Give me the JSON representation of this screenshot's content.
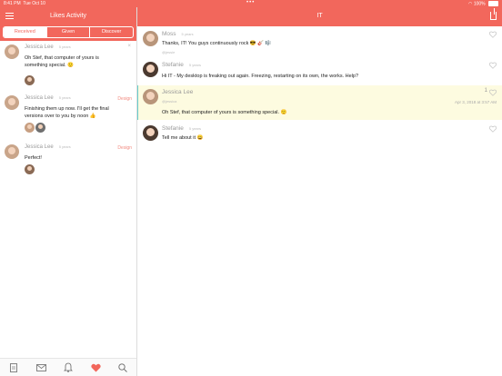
{
  "status_bar": {
    "time": "8:41 PM",
    "date": "Tue Oct 10",
    "battery": "100%"
  },
  "left": {
    "title": "Likes Activity",
    "tabs": [
      "Received",
      "Given",
      "Discover"
    ],
    "items": [
      {
        "name": "Jessica Lee",
        "ago": "5 years",
        "tag": "",
        "text": "Oh Stef, that computer of yours is something special. 🙂"
      },
      {
        "name": "Jessica Lee",
        "ago": "5 years",
        "tag": "Design",
        "text": "Finishing them up now. I'll get the final versions over to you by noon 👍"
      },
      {
        "name": "Jessica Lee",
        "ago": "5 years",
        "tag": "Design",
        "text": "Perfect!"
      }
    ]
  },
  "right": {
    "title": "IT",
    "posts": [
      {
        "name": "Moss",
        "ago": "5 years",
        "text": "Thanks, IT! You guys continuously rock 😎 🎸 🎼",
        "sub": "@jessie"
      },
      {
        "name": "Stefanie",
        "ago": "5 years",
        "text": "Hi IT - My desktop is freaking out again. Freezing, restarting on its own, the works. Help?",
        "sub": ""
      },
      {
        "name": "Jessica Lee",
        "ago": "",
        "sub": "@jessica",
        "text": "Oh Stef, that computer of yours is something special. 🙂",
        "count": "1",
        "date": "Apr 3, 2018 at 3:57 AM"
      },
      {
        "name": "Stefanie",
        "ago": "5 years",
        "text": "Tell me about it 😀",
        "sub": ""
      }
    ]
  },
  "colors": {
    "brand": "#f2675c",
    "highlight": "#fdfbe0",
    "liked": "#f2675c"
  }
}
